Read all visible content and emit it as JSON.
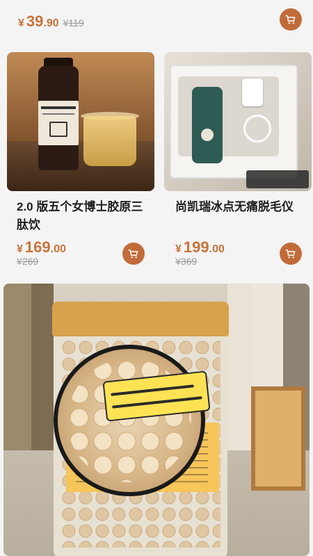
{
  "top_item": {
    "currency": "¥",
    "price_int": "39",
    "price_dec": ".90",
    "original_price": "¥119"
  },
  "products": [
    {
      "name": "2.0 版五个女博士胶原三肽饮",
      "currency": "¥",
      "price_int": "169",
      "price_dec": ".00",
      "original_price": "¥269"
    },
    {
      "name": "尚凯瑞冰点无痛脱毛仪",
      "currency": "¥",
      "price_int": "199",
      "price_dec": ".00",
      "original_price": "¥369"
    }
  ],
  "colors": {
    "price": "#c8733a",
    "cart_button": "#c26b3a",
    "background": "#f4f4f4",
    "text": "#1e1e1e",
    "strike": "#9a9a9a"
  },
  "icons": {
    "cart": "shopping-cart-icon"
  }
}
